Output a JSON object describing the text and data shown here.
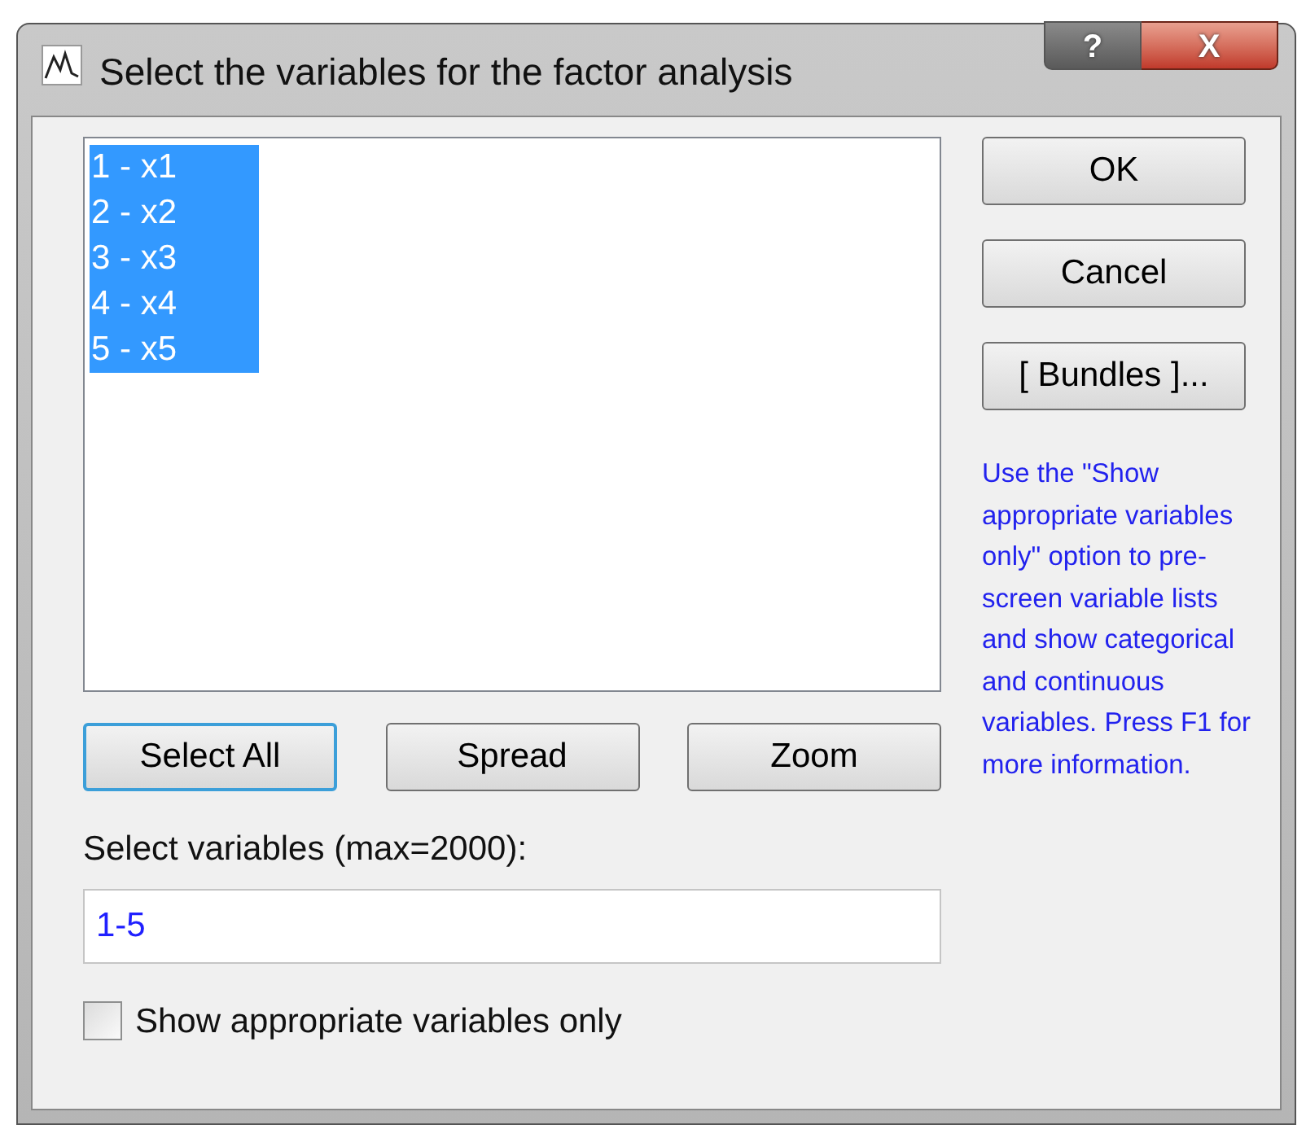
{
  "window": {
    "title": "Select the variables for the factor analysis",
    "controls": [
      "?",
      "X"
    ]
  },
  "variables": [
    {
      "label": "1 - x1",
      "selected": true
    },
    {
      "label": "2 - x2",
      "selected": true
    },
    {
      "label": "3 - x3",
      "selected": true
    },
    {
      "label": "4 - x4",
      "selected": true
    },
    {
      "label": "5 - x5",
      "selected": true
    }
  ],
  "list_buttons": [
    {
      "label": "Select All",
      "focused": true
    },
    {
      "label": "Spread",
      "focused": false
    },
    {
      "label": "Zoom",
      "focused": false
    }
  ],
  "select_field": {
    "label": "Select variables (max=2000):",
    "value": "1-5"
  },
  "checkbox": {
    "label": "Show appropriate variables only",
    "checked": false
  },
  "side_buttons": [
    "OK",
    "Cancel",
    "[ Bundles ]..."
  ],
  "help_text": "Use the \"Show appropriate variables only\" option to pre-screen variable lists and show categorical and continuous variables. Press F1 for more information."
}
